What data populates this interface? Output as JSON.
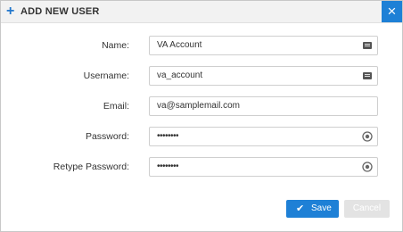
{
  "dialog": {
    "title": "ADD NEW USER",
    "close_symbol": "×"
  },
  "form": {
    "name_label": "Name:",
    "name_value": "VA Account",
    "username_label": "Username:",
    "username_value": "va_account",
    "email_label": "Email:",
    "email_value": "va@samplemail.com",
    "password_label": "Password:",
    "password_value": "••••••••",
    "retype_label": "Retype Password:",
    "retype_value": "••••••••"
  },
  "buttons": {
    "save_label": "Save",
    "cancel_label": "Cancel"
  },
  "icons": {
    "add": "plus-icon",
    "close": "close-icon",
    "keyboard": "keyboard-icon",
    "password_reveal": "eye-icon",
    "save": "check-icon"
  },
  "colors": {
    "accent": "#1e80d6",
    "disabled": "#e3e3e3"
  }
}
